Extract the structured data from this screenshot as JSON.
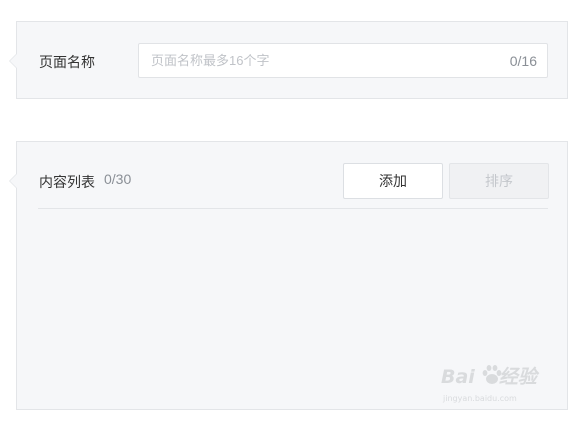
{
  "page_name_section": {
    "label": "页面名称",
    "input_placeholder": "页面名称最多16个字",
    "input_value": "",
    "counter": "0/16"
  },
  "content_list_section": {
    "label": "内容列表",
    "count": "0/30",
    "add_button": "添加",
    "sort_button": "排序",
    "items": []
  },
  "watermark": {
    "brand_text": "Bai",
    "brand_text2": "经验",
    "url": "jingyan.baidu.com"
  },
  "colors": {
    "panel_bg": "#f6f7f9",
    "border": "#e3e5e8",
    "text": "#333333",
    "muted": "#8a8f96",
    "placeholder": "#c0c3c8",
    "disabled_text": "#c4c7cc"
  }
}
